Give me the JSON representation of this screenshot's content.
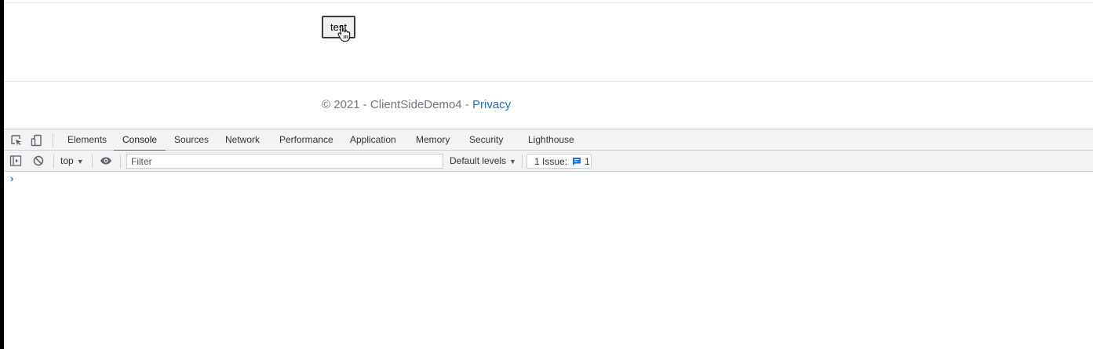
{
  "page": {
    "test_button_label": "test",
    "footer": {
      "prefix": "© 2021 - ClientSideDemo4 - ",
      "privacy_link": "Privacy"
    }
  },
  "devtools": {
    "tabs": [
      {
        "label": "Elements"
      },
      {
        "label": "Console",
        "active": true
      },
      {
        "label": "Sources"
      },
      {
        "label": "Network"
      },
      {
        "label": "Performance"
      },
      {
        "label": "Application"
      },
      {
        "label": "Memory"
      },
      {
        "label": "Security"
      },
      {
        "label": "Lighthouse"
      }
    ],
    "toolbar": {
      "context": "top",
      "filter_placeholder": "Filter",
      "levels": "Default levels",
      "issues_label": "1 Issue:",
      "issues_count": "1"
    },
    "console": {
      "prompt": "›"
    }
  },
  "colors": {
    "accent": "#1a73e8",
    "link": "#1b6ec2",
    "footer_text": "#6c757d",
    "devtools_bar": "#f1f3f4"
  },
  "icons": [
    "inspect-element-icon",
    "device-toggle-icon",
    "sidebar-toggle-icon",
    "clear-console-icon",
    "eye-icon",
    "issue-message-icon",
    "pointer-cursor-icon"
  ]
}
